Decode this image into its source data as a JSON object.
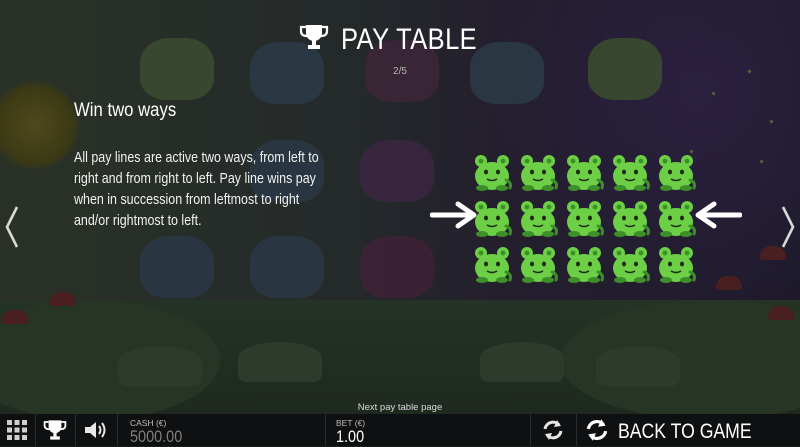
{
  "header": {
    "title": "PAY TABLE",
    "page_indicator": "2/5",
    "trophy_icon": "trophy-icon"
  },
  "content": {
    "heading": "Win two ways",
    "body": "All pay lines are active two ways, from left to right and from right to left. Pay line wins pay when in succession from leftmost to right and/or rightmost to left.",
    "illustration": {
      "symbol": "green-frog-monster",
      "rows": 3,
      "columns": 5,
      "arrows": [
        "arrow-right-icon",
        "arrow-left-icon"
      ]
    }
  },
  "navigation": {
    "prev_icon": "chevron-left-icon",
    "next_icon": "chevron-right-icon",
    "next_page_label": "Next pay table page"
  },
  "bottom_bar": {
    "menu_icon": "grid-menu-icon",
    "paytable_icon": "trophy-icon",
    "sound_icon": "speaker-icon",
    "cash_label": "CASH (€)",
    "cash_value": "5000.00",
    "bet_label": "BET (€)",
    "bet_value": "1.00",
    "refresh_icon": "refresh-icon",
    "back_label": "BACK TO GAME"
  },
  "colors": {
    "frog_green": "#6ccf45",
    "frog_dark": "#3d8f2a",
    "bar_bg": "#0f1011",
    "text": "#ffffff"
  }
}
